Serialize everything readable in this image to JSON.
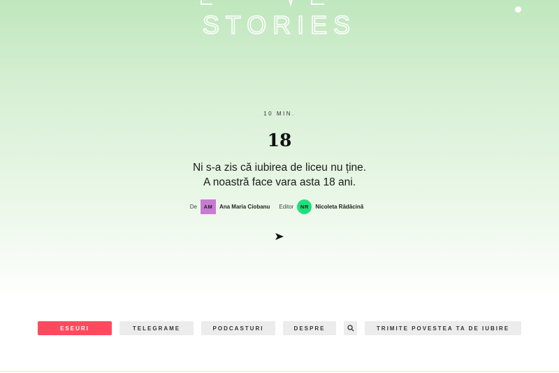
{
  "header": {
    "logo_bottom_text": "STORIES"
  },
  "article": {
    "read_time": "10 MIN.",
    "title": "18",
    "subtitle_line1": "Ni s-a zis că iubirea de liceu nu ține.",
    "subtitle_line2": "A noastră face vara asta 18 ani.",
    "author_label": "De",
    "author_initials": "AM",
    "author_name": "Ana Maria Ciobanu",
    "editor_label": "Editor",
    "editor_initials": "NR",
    "editor_name": "Nicoleta Rădăcină"
  },
  "nav": {
    "items": [
      {
        "label": "ESEURI",
        "active": true
      },
      {
        "label": "TELEGRAME",
        "active": false
      },
      {
        "label": "PODCASTURI",
        "active": false
      },
      {
        "label": "DESPRE",
        "active": false
      },
      {
        "label": "TRIMITE POVESTEA TA DE IUBIRE",
        "active": false
      }
    ],
    "search_icon": "search-icon"
  },
  "colors": {
    "accent": "#ff4a5e",
    "author_badge": "#c77bd1",
    "editor_badge": "#1ee07a",
    "nav_button_bg": "#ececec"
  }
}
